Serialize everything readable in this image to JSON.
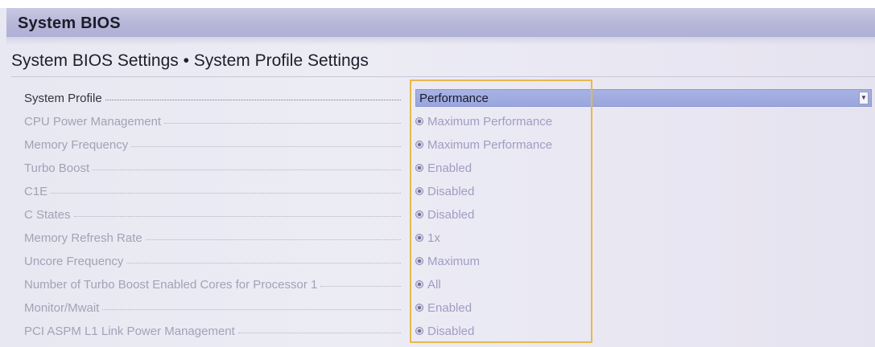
{
  "window": {
    "title": "System BIOS"
  },
  "breadcrumb": "System BIOS Settings • System Profile Settings",
  "colors": {
    "highlight": "#e8b84a",
    "select_bg": "#a7b3e4",
    "title_bar": "#b7b6d8"
  },
  "settings": [
    {
      "label": "System Profile",
      "value": "Performance",
      "control": "dropdown"
    },
    {
      "label": "CPU Power Management",
      "value": "Maximum Performance",
      "control": "radio"
    },
    {
      "label": "Memory Frequency",
      "value": "Maximum Performance",
      "control": "radio"
    },
    {
      "label": "Turbo Boost",
      "value": "Enabled",
      "control": "radio"
    },
    {
      "label": "C1E",
      "value": "Disabled",
      "control": "radio"
    },
    {
      "label": "C States",
      "value": "Disabled",
      "control": "radio"
    },
    {
      "label": "Memory Refresh Rate",
      "value": "1x",
      "control": "radio"
    },
    {
      "label": "Uncore Frequency",
      "value": "Maximum",
      "control": "radio"
    },
    {
      "label": "Number of Turbo Boost Enabled Cores for Processor 1",
      "value": "All",
      "control": "radio"
    },
    {
      "label": "Monitor/Mwait",
      "value": "Enabled",
      "control": "radio"
    },
    {
      "label": "PCI ASPM L1 Link Power Management",
      "value": "Disabled",
      "control": "radio"
    }
  ],
  "icons": {
    "dropdown": "chevron-down-icon",
    "radio": "radio-selected-icon"
  }
}
